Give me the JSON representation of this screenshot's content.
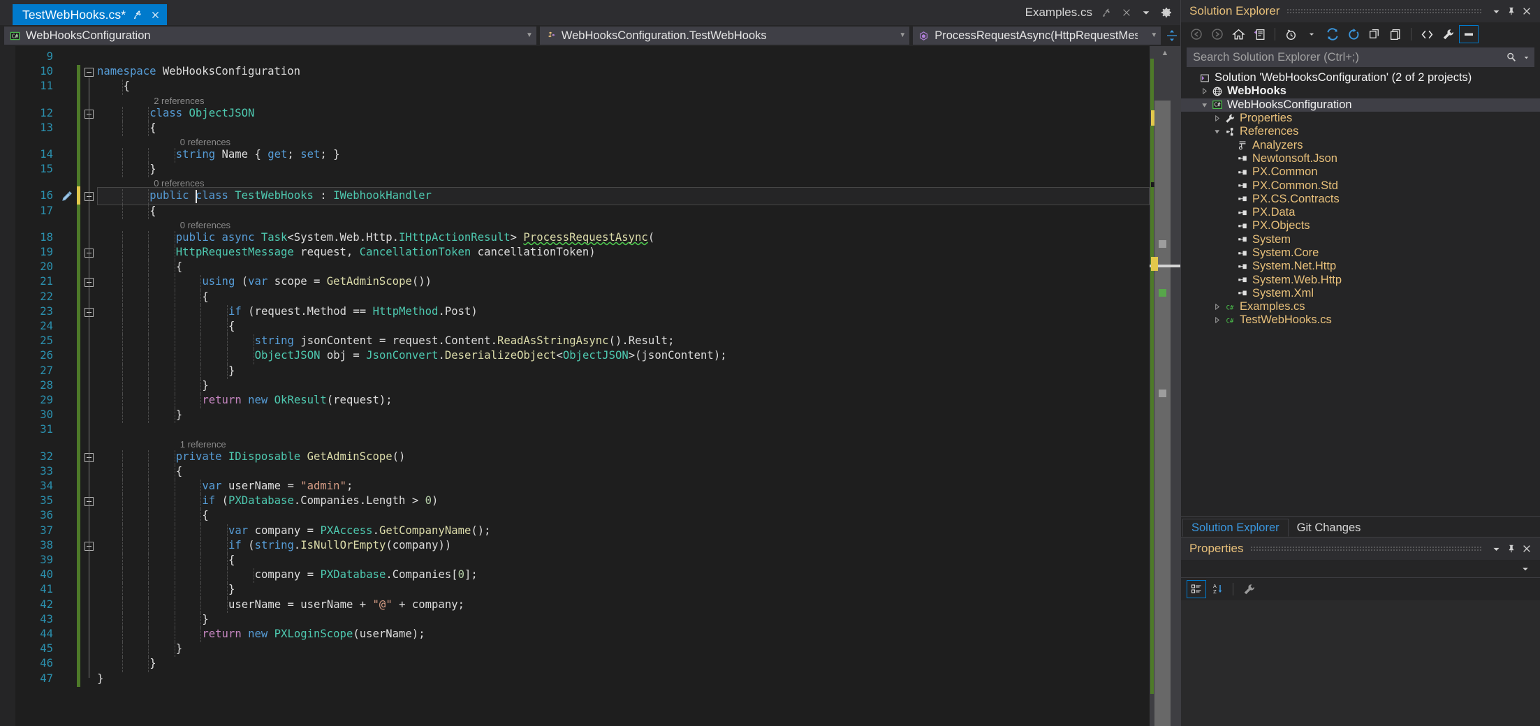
{
  "window": {
    "tab": {
      "title": "TestWebHooks.cs*",
      "pin_icon": "pin-icon",
      "close_icon": "close-icon"
    },
    "right_doc": {
      "name": "Examples.cs",
      "pin_icon": "pin-icon",
      "close_icon": "close-icon",
      "dropdown_icon": "chevron-down-icon",
      "settings_icon": "gear-icon"
    }
  },
  "navbar": {
    "namespace": {
      "label": "WebHooksConfiguration",
      "icon": "csharp-file-icon"
    },
    "class": {
      "label": "WebHooksConfiguration.TestWebHooks",
      "icon": "class-icon"
    },
    "member": {
      "label": "ProcessRequestAsync(HttpRequestMessage request, CancellationTo",
      "icon": "method-icon"
    },
    "split_icon": "split-view-icon"
  },
  "editor": {
    "first_line_number": 9,
    "lines": [
      {
        "n": 9,
        "indent": 0,
        "tokens": []
      },
      {
        "n": 10,
        "indent": 0,
        "fold": true,
        "tokens": [
          {
            "t": "namespace ",
            "c": "k"
          },
          {
            "t": "WebHooksConfiguration",
            "c": "p"
          }
        ]
      },
      {
        "n": 11,
        "indent": 1,
        "tokens": [
          {
            "t": "{",
            "c": "p"
          }
        ]
      },
      {
        "n": 12,
        "indent": 2,
        "fold": true,
        "lens": "2 references",
        "tokens": [
          {
            "t": "class ",
            "c": "k"
          },
          {
            "t": "ObjectJSON",
            "c": "t"
          }
        ]
      },
      {
        "n": 13,
        "indent": 2,
        "tokens": [
          {
            "t": "{",
            "c": "p"
          }
        ]
      },
      {
        "n": 14,
        "indent": 3,
        "lens": "0 references",
        "tokens": [
          {
            "t": "string ",
            "c": "k"
          },
          {
            "t": "Name",
            "c": "p"
          },
          {
            "t": " { ",
            "c": "p"
          },
          {
            "t": "get",
            "c": "k"
          },
          {
            "t": "; ",
            "c": "p"
          },
          {
            "t": "set",
            "c": "k"
          },
          {
            "t": "; }",
            "c": "p"
          }
        ]
      },
      {
        "n": 15,
        "indent": 2,
        "tokens": [
          {
            "t": "}",
            "c": "p"
          }
        ]
      },
      {
        "n": 16,
        "indent": 2,
        "current": true,
        "fold": true,
        "lens": "0 references",
        "edited": true,
        "tokens": [
          {
            "t": "public ",
            "c": "k"
          },
          {
            "t": "class ",
            "c": "k"
          },
          {
            "t": "TestWebHooks",
            "c": "t"
          },
          {
            "t": " : ",
            "c": "p"
          },
          {
            "t": "IWebhookHandler",
            "c": "t"
          }
        ]
      },
      {
        "n": 17,
        "indent": 2,
        "tokens": [
          {
            "t": "{",
            "c": "p"
          }
        ]
      },
      {
        "n": 18,
        "indent": 3,
        "lens": "0 references",
        "tokens": [
          {
            "t": "public ",
            "c": "k"
          },
          {
            "t": "async ",
            "c": "k"
          },
          {
            "t": "Task",
            "c": "t"
          },
          {
            "t": "<System.Web.Http.",
            "c": "p"
          },
          {
            "t": "IHttpActionResult",
            "c": "t"
          },
          {
            "t": "> ",
            "c": "p"
          },
          {
            "t": "ProcessRequestAsync",
            "c": "m sq"
          },
          {
            "t": "(",
            "c": "p"
          }
        ]
      },
      {
        "n": 19,
        "indent": 3,
        "fold": true,
        "tokens": [
          {
            "t": "HttpRequestMessage",
            "c": "t"
          },
          {
            "t": " request, ",
            "c": "p"
          },
          {
            "t": "CancellationToken",
            "c": "t"
          },
          {
            "t": " cancellationToken)",
            "c": "p"
          }
        ]
      },
      {
        "n": 20,
        "indent": 3,
        "tokens": [
          {
            "t": "{",
            "c": "p"
          }
        ]
      },
      {
        "n": 21,
        "indent": 4,
        "fold": true,
        "tokens": [
          {
            "t": "using ",
            "c": "kc"
          },
          {
            "t": "(",
            "c": "p"
          },
          {
            "t": "var ",
            "c": "k"
          },
          {
            "t": "scope = ",
            "c": "p"
          },
          {
            "t": "GetAdminScope",
            "c": "m"
          },
          {
            "t": "())",
            "c": "p"
          }
        ]
      },
      {
        "n": 22,
        "indent": 4,
        "tokens": [
          {
            "t": "{",
            "c": "p"
          }
        ]
      },
      {
        "n": 23,
        "indent": 5,
        "fold": true,
        "tokens": [
          {
            "t": "if ",
            "c": "kc"
          },
          {
            "t": "(request.Method == ",
            "c": "p"
          },
          {
            "t": "HttpMethod",
            "c": "t"
          },
          {
            "t": ".Post)",
            "c": "p"
          }
        ]
      },
      {
        "n": 24,
        "indent": 5,
        "tokens": [
          {
            "t": "{",
            "c": "p"
          }
        ]
      },
      {
        "n": 25,
        "indent": 6,
        "tokens": [
          {
            "t": "string ",
            "c": "k"
          },
          {
            "t": "jsonContent = request.Content.",
            "c": "p"
          },
          {
            "t": "ReadAsStringAsync",
            "c": "m"
          },
          {
            "t": "().Result;",
            "c": "p"
          }
        ]
      },
      {
        "n": 26,
        "indent": 6,
        "tokens": [
          {
            "t": "ObjectJSON",
            "c": "t"
          },
          {
            "t": " obj = ",
            "c": "p"
          },
          {
            "t": "JsonConvert",
            "c": "t"
          },
          {
            "t": ".",
            "c": "p"
          },
          {
            "t": "DeserializeObject",
            "c": "m"
          },
          {
            "t": "<",
            "c": "p"
          },
          {
            "t": "ObjectJSON",
            "c": "t"
          },
          {
            "t": ">(jsonContent);",
            "c": "p"
          }
        ]
      },
      {
        "n": 27,
        "indent": 5,
        "tokens": [
          {
            "t": "}",
            "c": "p"
          }
        ]
      },
      {
        "n": 28,
        "indent": 4,
        "tokens": [
          {
            "t": "}",
            "c": "p"
          }
        ]
      },
      {
        "n": 29,
        "indent": 4,
        "tokens": [
          {
            "t": "return ",
            "c": "cw"
          },
          {
            "t": "new ",
            "c": "k"
          },
          {
            "t": "OkResult",
            "c": "t"
          },
          {
            "t": "(request);",
            "c": "p"
          }
        ]
      },
      {
        "n": 30,
        "indent": 3,
        "tokens": [
          {
            "t": "}",
            "c": "p"
          }
        ]
      },
      {
        "n": 31,
        "indent": 0,
        "tokens": []
      },
      {
        "n": 32,
        "indent": 3,
        "fold": true,
        "lens": "1 reference",
        "tokens": [
          {
            "t": "private ",
            "c": "k"
          },
          {
            "t": "IDisposable",
            "c": "t"
          },
          {
            "t": " ",
            "c": "p"
          },
          {
            "t": "GetAdminScope",
            "c": "m"
          },
          {
            "t": "()",
            "c": "p"
          }
        ]
      },
      {
        "n": 33,
        "indent": 3,
        "tokens": [
          {
            "t": "{",
            "c": "p"
          }
        ]
      },
      {
        "n": 34,
        "indent": 4,
        "tokens": [
          {
            "t": "var ",
            "c": "k"
          },
          {
            "t": "userName = ",
            "c": "p"
          },
          {
            "t": "\"admin\"",
            "c": "s"
          },
          {
            "t": ";",
            "c": "p"
          }
        ]
      },
      {
        "n": 35,
        "indent": 4,
        "fold": true,
        "tokens": [
          {
            "t": "if ",
            "c": "kc"
          },
          {
            "t": "(",
            "c": "p"
          },
          {
            "t": "PXDatabase",
            "c": "t"
          },
          {
            "t": ".Companies.Length > ",
            "c": "p"
          },
          {
            "t": "0",
            "c": "n"
          },
          {
            "t": ")",
            "c": "p"
          }
        ]
      },
      {
        "n": 36,
        "indent": 4,
        "tokens": [
          {
            "t": "{",
            "c": "p"
          }
        ]
      },
      {
        "n": 37,
        "indent": 5,
        "tokens": [
          {
            "t": "var ",
            "c": "k"
          },
          {
            "t": "company = ",
            "c": "p"
          },
          {
            "t": "PXAccess",
            "c": "t"
          },
          {
            "t": ".",
            "c": "p"
          },
          {
            "t": "GetCompanyName",
            "c": "m"
          },
          {
            "t": "();",
            "c": "p"
          }
        ]
      },
      {
        "n": 38,
        "indent": 5,
        "fold": true,
        "tokens": [
          {
            "t": "if ",
            "c": "kc"
          },
          {
            "t": "(",
            "c": "p"
          },
          {
            "t": "string",
            "c": "k"
          },
          {
            "t": ".",
            "c": "p"
          },
          {
            "t": "IsNullOrEmpty",
            "c": "m"
          },
          {
            "t": "(company))",
            "c": "p"
          }
        ]
      },
      {
        "n": 39,
        "indent": 5,
        "tokens": [
          {
            "t": "{",
            "c": "p"
          }
        ]
      },
      {
        "n": 40,
        "indent": 6,
        "tokens": [
          {
            "t": "company = ",
            "c": "p"
          },
          {
            "t": "PXDatabase",
            "c": "t"
          },
          {
            "t": ".Companies[",
            "c": "p"
          },
          {
            "t": "0",
            "c": "n"
          },
          {
            "t": "];",
            "c": "p"
          }
        ]
      },
      {
        "n": 41,
        "indent": 5,
        "tokens": [
          {
            "t": "}",
            "c": "p"
          }
        ]
      },
      {
        "n": 42,
        "indent": 5,
        "tokens": [
          {
            "t": "userName = userName + ",
            "c": "p"
          },
          {
            "t": "\"@\"",
            "c": "s"
          },
          {
            "t": " + company;",
            "c": "p"
          }
        ]
      },
      {
        "n": 43,
        "indent": 4,
        "tokens": [
          {
            "t": "}",
            "c": "p"
          }
        ]
      },
      {
        "n": 44,
        "indent": 4,
        "tokens": [
          {
            "t": "return ",
            "c": "cw"
          },
          {
            "t": "new ",
            "c": "k"
          },
          {
            "t": "PXLoginScope",
            "c": "t"
          },
          {
            "t": "(userName);",
            "c": "p"
          }
        ]
      },
      {
        "n": 45,
        "indent": 3,
        "tokens": [
          {
            "t": "}",
            "c": "p"
          }
        ]
      },
      {
        "n": 46,
        "indent": 2,
        "tokens": [
          {
            "t": "}",
            "c": "p"
          }
        ]
      },
      {
        "n": 47,
        "indent": 0,
        "tokens": [
          {
            "t": "}",
            "c": "p"
          }
        ]
      }
    ]
  },
  "solution_explorer": {
    "title": "Solution Explorer",
    "header_buttons": [
      {
        "name": "dropdown-icon",
        "glyph": "▼"
      },
      {
        "name": "pin-icon",
        "glyph": "pin"
      },
      {
        "name": "close-icon",
        "glyph": "✕"
      }
    ],
    "toolbar": [
      "back-icon",
      "forward-icon",
      "home-icon",
      "pending-changes-icon",
      "view-history-icon",
      "history-dropdown-icon",
      "sync-with-active-document-icon",
      "refresh-icon",
      "collapse-all-icon",
      "show-all-files-icon",
      "view-code-icon",
      "properties-wrench-icon",
      "preview-selected-items-icon"
    ],
    "search_placeholder": "Search Solution Explorer (Ctrl+;)",
    "search_value": "",
    "search_icon": "search-icon",
    "search_dropdown_icon": "chevron-down-icon",
    "tree": [
      {
        "label": "Solution 'WebHooksConfiguration' (2 of 2 projects)",
        "depth": 0,
        "expander": "none",
        "icon": "solution-icon",
        "style": "white"
      },
      {
        "label": "WebHooks",
        "depth": 1,
        "expander": "collapsed",
        "icon": "web-project-icon",
        "style": "bold"
      },
      {
        "label": "WebHooksConfiguration",
        "depth": 1,
        "expander": "expanded",
        "icon": "csharp-project-icon",
        "style": "white",
        "selected": true
      },
      {
        "label": "Properties",
        "depth": 2,
        "expander": "collapsed",
        "icon": "wrench-icon"
      },
      {
        "label": "References",
        "depth": 2,
        "expander": "expanded",
        "icon": "references-icon"
      },
      {
        "label": "Analyzers",
        "depth": 3,
        "expander": "none",
        "icon": "analyzer-icon"
      },
      {
        "label": "Newtonsoft.Json",
        "depth": 3,
        "expander": "none",
        "icon": "reference-icon"
      },
      {
        "label": "PX.Common",
        "depth": 3,
        "expander": "none",
        "icon": "reference-icon"
      },
      {
        "label": "PX.Common.Std",
        "depth": 3,
        "expander": "none",
        "icon": "reference-icon"
      },
      {
        "label": "PX.CS.Contracts",
        "depth": 3,
        "expander": "none",
        "icon": "reference-icon"
      },
      {
        "label": "PX.Data",
        "depth": 3,
        "expander": "none",
        "icon": "reference-icon"
      },
      {
        "label": "PX.Objects",
        "depth": 3,
        "expander": "none",
        "icon": "reference-icon"
      },
      {
        "label": "System",
        "depth": 3,
        "expander": "none",
        "icon": "reference-icon"
      },
      {
        "label": "System.Core",
        "depth": 3,
        "expander": "none",
        "icon": "reference-icon"
      },
      {
        "label": "System.Net.Http",
        "depth": 3,
        "expander": "none",
        "icon": "reference-icon"
      },
      {
        "label": "System.Web.Http",
        "depth": 3,
        "expander": "none",
        "icon": "reference-icon"
      },
      {
        "label": "System.Xml",
        "depth": 3,
        "expander": "none",
        "icon": "reference-icon"
      },
      {
        "label": "Examples.cs",
        "depth": 2,
        "expander": "collapsed",
        "icon": "csharp-file-icon"
      },
      {
        "label": "TestWebHooks.cs",
        "depth": 2,
        "expander": "collapsed",
        "icon": "csharp-file-icon"
      }
    ]
  },
  "bottom_tabs": [
    {
      "label": "Solution Explorer",
      "active": true
    },
    {
      "label": "Git Changes",
      "active": false
    }
  ],
  "properties": {
    "title": "Properties",
    "header_buttons": [
      {
        "name": "dropdown-icon",
        "glyph": "▼"
      },
      {
        "name": "pin-icon",
        "glyph": "pin"
      },
      {
        "name": "close-icon",
        "glyph": "✕"
      }
    ],
    "object_selector_value": "",
    "object_selector_icon": "chevron-down-icon",
    "toolbar": [
      "categorized-icon",
      "alphabetical-icon",
      "property-pages-icon"
    ]
  },
  "colors": {
    "accent": "#007acc",
    "tab_active_bg": "#007acc",
    "editor_bg": "#1e1e1e",
    "panel_bg": "#252526",
    "keyword": "#569cd6",
    "type": "#4ec9b0",
    "string": "#d69d85",
    "method": "#dcdcaa",
    "control": "#c586c0",
    "number": "#b5cea8",
    "linenumber": "#2b91af",
    "tree_text": "#e8c07a",
    "changebar_saved": "#4e7a29",
    "changebar_unsaved": "#e3c84b"
  }
}
